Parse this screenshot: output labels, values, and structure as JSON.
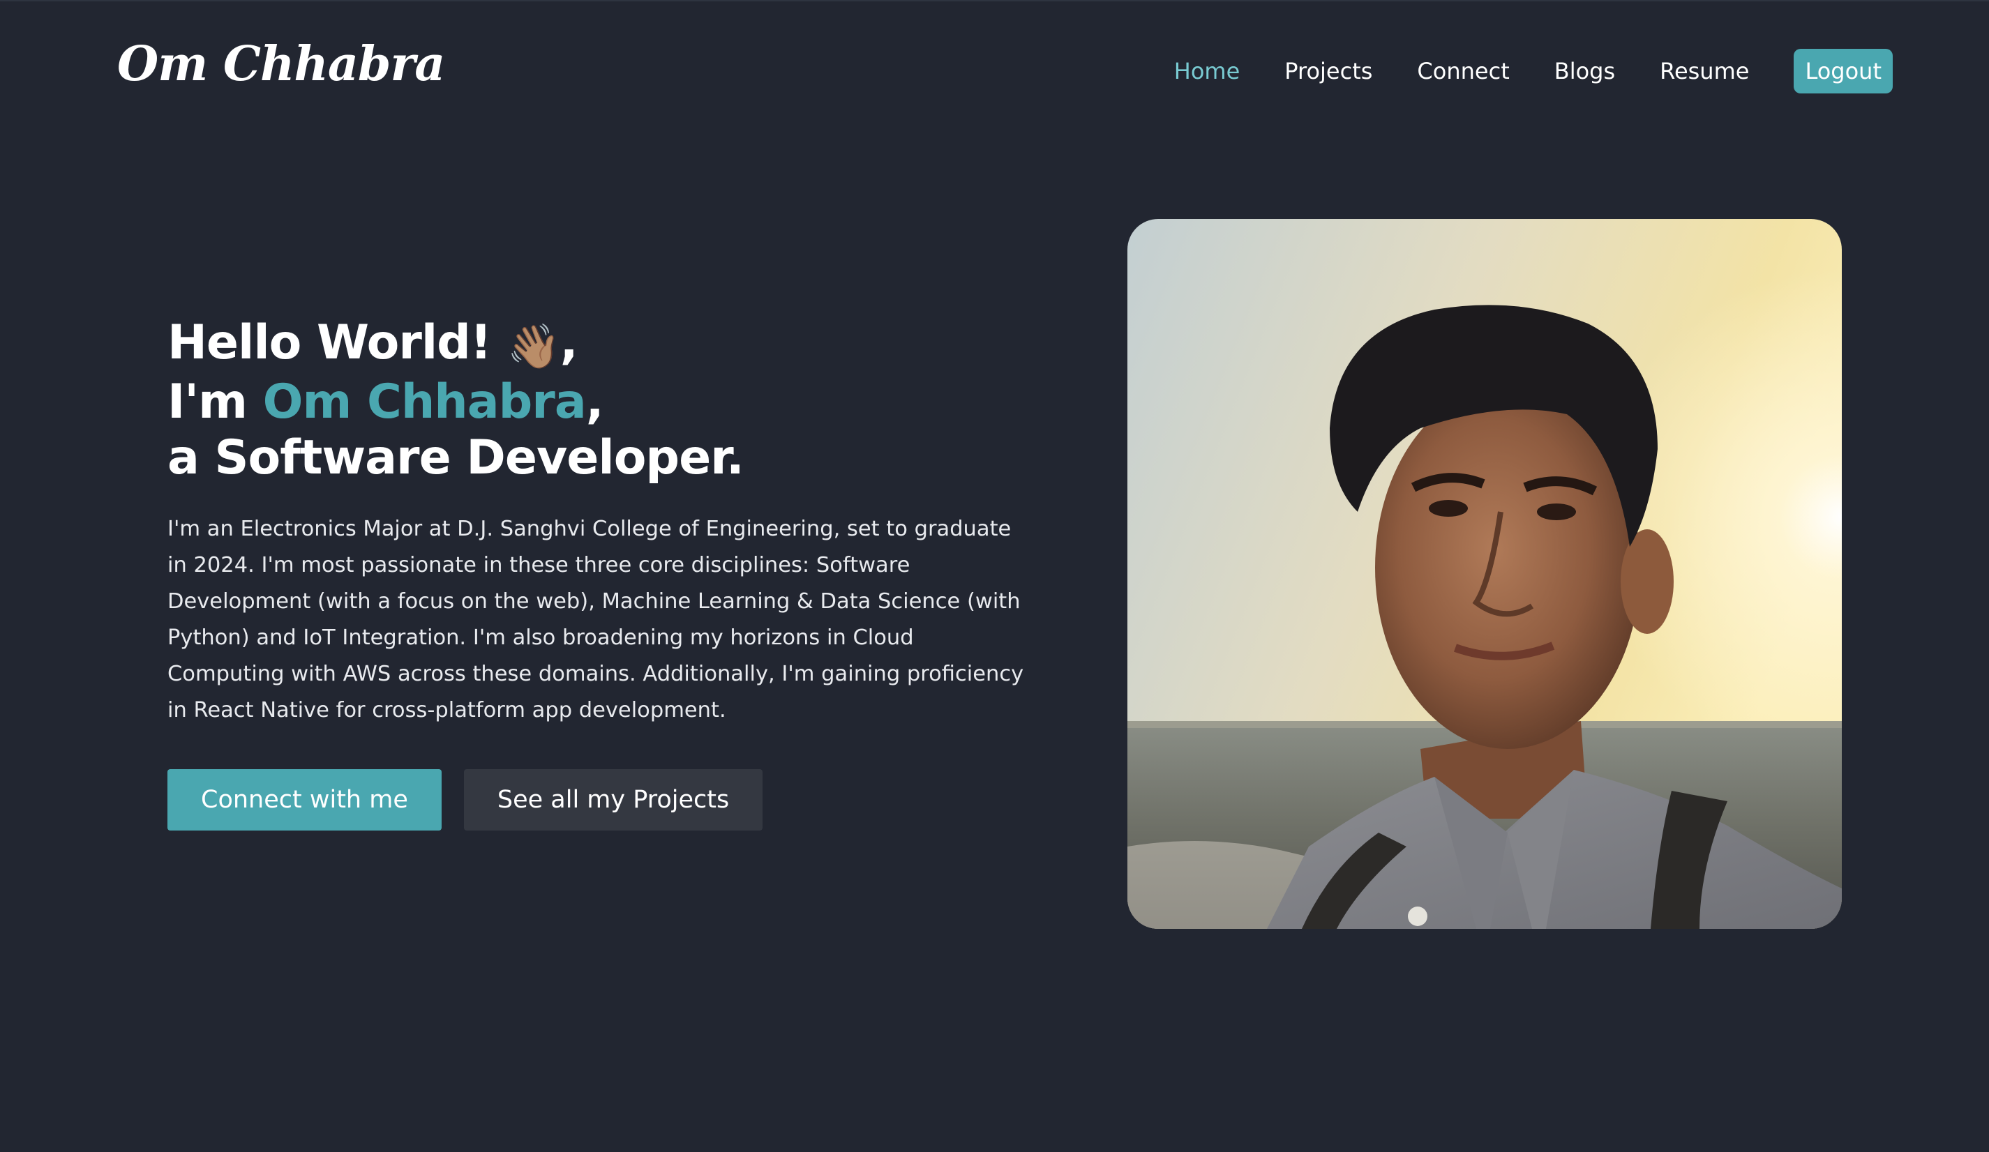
{
  "nav": {
    "logo": "Om Chhabra",
    "links": [
      "Home",
      "Projects",
      "Connect",
      "Blogs",
      "Resume"
    ],
    "active_link": "Home",
    "logout_label": "Logout"
  },
  "hero": {
    "line1": "Hello World! ",
    "wave_emoji": "👋🏽",
    "line1_suffix": ",",
    "line2_prefix": "I'm ",
    "name": "Om Chhabra",
    "line2_suffix": ",",
    "line3": "a Software Developer.",
    "bio": "I'm an Electronics Major at D.J. Sanghvi College of Engineering, set to graduate in 2024. I'm most passionate in these three core disciplines: Software Development (with a focus on the web), Machine Learning & Data Science (with Python) and IoT Integration. I'm also broadening my horizons in Cloud Computing with AWS across these domains. Additionally, I'm gaining proficiency in React Native for cross-platform app development.",
    "primary_button": "Connect with me",
    "secondary_button": "See all my Projects"
  },
  "colors": {
    "background": "#222631",
    "accent": "#4aa7b0",
    "nav_active": "#79cbd2",
    "secondary_button": "#343841"
  }
}
